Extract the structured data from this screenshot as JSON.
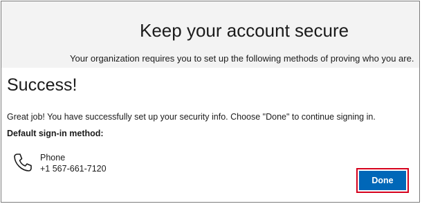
{
  "header": {
    "title": "Keep your account secure",
    "subtitle": "Your organization requires you to set up the following methods of proving who you are."
  },
  "main": {
    "success_title": "Success!",
    "message": "Great job! You have successfully set up your security info. Choose \"Done\" to continue signing in.",
    "default_method_label": "Default sign-in method:",
    "method": {
      "icon": "phone-icon",
      "name": "Phone",
      "value": "+1 567-661-7120"
    }
  },
  "actions": {
    "done_label": "Done"
  },
  "colors": {
    "accent": "#0067b8",
    "highlight_border": "#d5001c",
    "header_bg": "#f3f3f3"
  }
}
